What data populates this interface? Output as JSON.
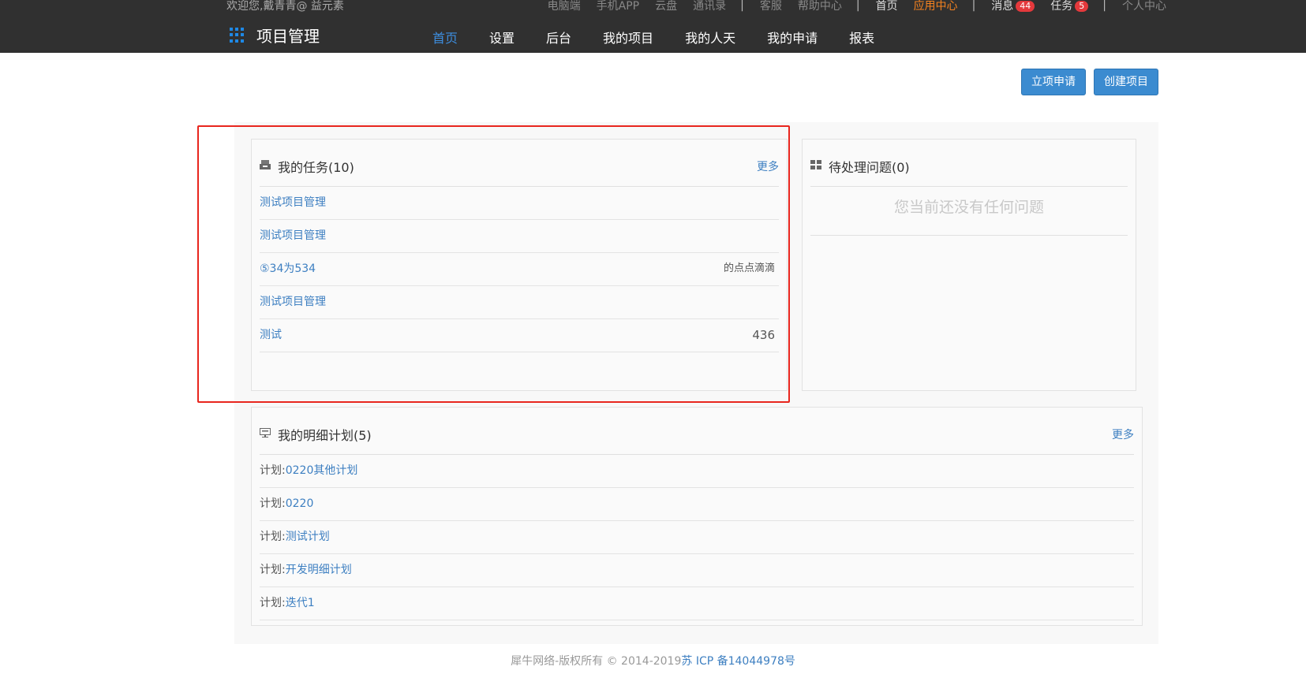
{
  "topbar": {
    "welcome": "欢迎您,戴青青@ 益元素",
    "links": [
      "电脑端",
      "手机APP",
      "云盘",
      "通讯录",
      "客服",
      "帮助中心",
      "首页",
      "应用中心",
      "消息",
      "任务",
      "个人中心"
    ],
    "message_count": "44",
    "task_count": "5"
  },
  "brand": {
    "title": "项目管理"
  },
  "nav": [
    "首页",
    "设置",
    "后台",
    "我的项目",
    "我的人天",
    "我的申请",
    "报表"
  ],
  "actions": {
    "apply": "立项申请",
    "create": "创建项目"
  },
  "tasks": {
    "title": "我的任务(10)",
    "more": "更多",
    "items": [
      {
        "name": "测试项目管理",
        "right": ""
      },
      {
        "name": "测试项目管理",
        "right": ""
      },
      {
        "name": "⑤34为534",
        "right": "的点点滴滴"
      },
      {
        "name": "测试项目管理",
        "right": ""
      },
      {
        "name": "测试",
        "right": "436"
      }
    ]
  },
  "issues": {
    "title": "待处理问题(0)",
    "empty": "您当前还没有任何问题"
  },
  "plans": {
    "title": "我的明细计划(5)",
    "more": "更多",
    "prefix": "计划:",
    "items": [
      "0220其他计划",
      "0220",
      "测试计划",
      "开发明细计划",
      "迭代1"
    ]
  },
  "footer": {
    "copyright": "犀牛网络-版权所有 © 2014-2019",
    "icp": "苏 ICP 备14044978号"
  },
  "colors": {
    "topbar": "#303030",
    "accent": "#3d8ee0",
    "button": "#3b8bd0",
    "highlight": "#e8261e"
  }
}
